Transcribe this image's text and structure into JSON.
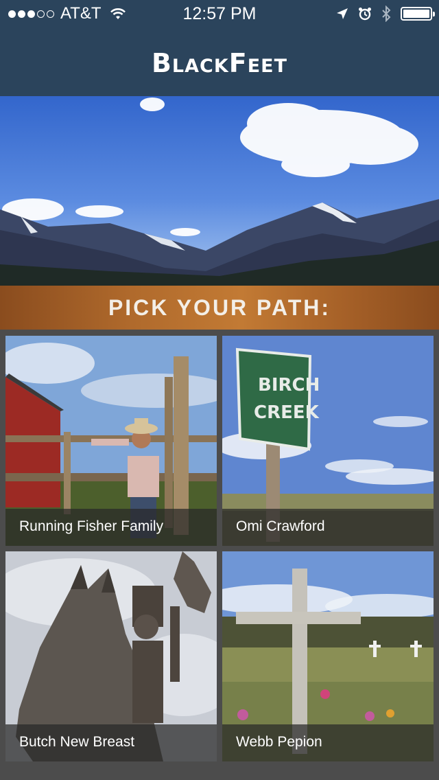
{
  "status_bar": {
    "carrier": "AT&T",
    "time": "12:57 PM",
    "signal_bars_filled": 3,
    "signal_bars_total": 5,
    "icons": [
      "wifi-icon",
      "location-arrow-icon",
      "alarm-clock-icon",
      "bluetooth-icon",
      "battery-icon"
    ],
    "battery_level": 1.0
  },
  "header": {
    "title": "BlackFeet",
    "background_color": "#2b445c"
  },
  "hero": {
    "image": "mountain-landscape-photo"
  },
  "banner": {
    "text": "PICK YOUR PATH:",
    "color": "#b06a2c"
  },
  "paths": [
    {
      "label": "Running Fisher Family",
      "image": "man-leaning-on-fence-photo"
    },
    {
      "label": "Omi Crawford",
      "image": "birch-creek-sign-photo"
    },
    {
      "label": "Butch New Breast",
      "image": "metal-horse-rider-statue-photo"
    },
    {
      "label": "Webb Pepion",
      "image": "cemetery-cross-photo"
    }
  ]
}
